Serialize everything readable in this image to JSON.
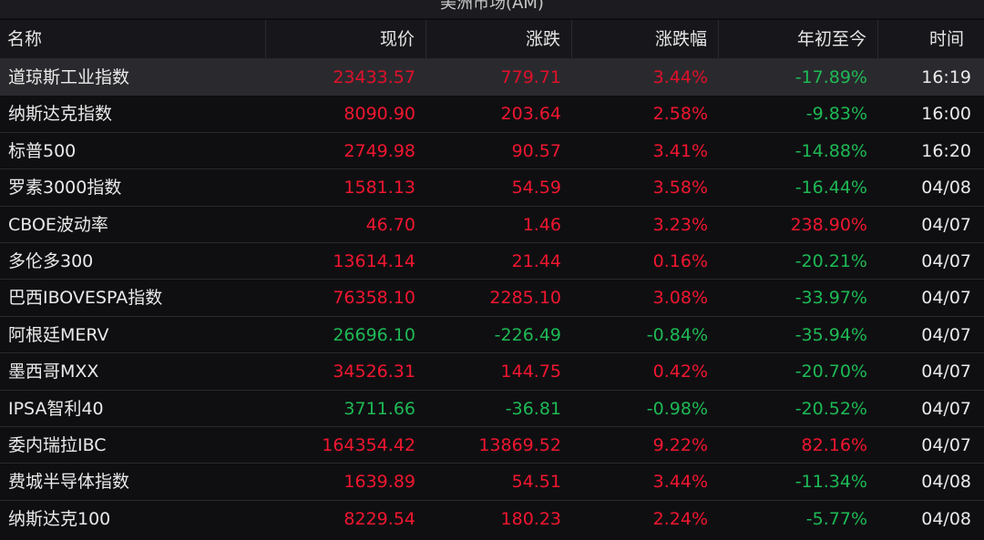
{
  "panel": {
    "title": "美洲市场(AM)"
  },
  "columns": {
    "name": "名称",
    "price": "现价",
    "change": "涨跌",
    "change_pct": "涨跌幅",
    "ytd": "年初至今",
    "time": "时间"
  },
  "colors": {
    "up": "#f0162f",
    "down": "#1eb954",
    "background": "#0f0f12",
    "selected_row": "#2a2a2e"
  },
  "rows": [
    {
      "name": "道琼斯工业指数",
      "price": "23433.57",
      "change": "779.71",
      "change_pct": "3.44%",
      "ytd": "-17.89%",
      "time": "16:19",
      "dir": "up",
      "ytd_dir": "down",
      "selected": true
    },
    {
      "name": "纳斯达克指数",
      "price": "8090.90",
      "change": "203.64",
      "change_pct": "2.58%",
      "ytd": "-9.83%",
      "time": "16:00",
      "dir": "up",
      "ytd_dir": "down"
    },
    {
      "name": "标普500",
      "price": "2749.98",
      "change": "90.57",
      "change_pct": "3.41%",
      "ytd": "-14.88%",
      "time": "16:20",
      "dir": "up",
      "ytd_dir": "down"
    },
    {
      "name": "罗素3000指数",
      "price": "1581.13",
      "change": "54.59",
      "change_pct": "3.58%",
      "ytd": "-16.44%",
      "time": "04/08",
      "dir": "up",
      "ytd_dir": "down"
    },
    {
      "name": "CBOE波动率",
      "price": "46.70",
      "change": "1.46",
      "change_pct": "3.23%",
      "ytd": "238.90%",
      "time": "04/07",
      "dir": "up",
      "ytd_dir": "up"
    },
    {
      "name": "多伦多300",
      "price": "13614.14",
      "change": "21.44",
      "change_pct": "0.16%",
      "ytd": "-20.21%",
      "time": "04/07",
      "dir": "up",
      "ytd_dir": "down"
    },
    {
      "name": "巴西IBOVESPA指数",
      "price": "76358.10",
      "change": "2285.10",
      "change_pct": "3.08%",
      "ytd": "-33.97%",
      "time": "04/07",
      "dir": "up",
      "ytd_dir": "down"
    },
    {
      "name": "阿根廷MERV",
      "price": "26696.10",
      "change": "-226.49",
      "change_pct": "-0.84%",
      "ytd": "-35.94%",
      "time": "04/07",
      "dir": "down",
      "ytd_dir": "down"
    },
    {
      "name": "墨西哥MXX",
      "price": "34526.31",
      "change": "144.75",
      "change_pct": "0.42%",
      "ytd": "-20.70%",
      "time": "04/07",
      "dir": "up",
      "ytd_dir": "down"
    },
    {
      "name": "IPSA智利40",
      "price": "3711.66",
      "change": "-36.81",
      "change_pct": "-0.98%",
      "ytd": "-20.52%",
      "time": "04/07",
      "dir": "down",
      "ytd_dir": "down"
    },
    {
      "name": "委内瑞拉IBC",
      "price": "164354.42",
      "change": "13869.52",
      "change_pct": "9.22%",
      "ytd": "82.16%",
      "time": "04/07",
      "dir": "up",
      "ytd_dir": "up"
    },
    {
      "name": "费城半导体指数",
      "price": "1639.89",
      "change": "54.51",
      "change_pct": "3.44%",
      "ytd": "-11.34%",
      "time": "04/08",
      "dir": "up",
      "ytd_dir": "down"
    },
    {
      "name": "纳斯达克100",
      "price": "8229.54",
      "change": "180.23",
      "change_pct": "2.24%",
      "ytd": "-5.77%",
      "time": "04/08",
      "dir": "up",
      "ytd_dir": "down"
    }
  ]
}
